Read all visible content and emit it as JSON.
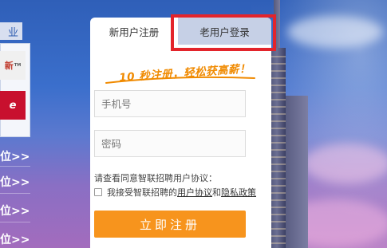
{
  "left": {
    "top_tab": "业",
    "logo_1_text": "新",
    "logo_1_sub": "TM",
    "logo_2_text": "e",
    "links": [
      "位>>",
      "位>>",
      "位>>",
      "位>>"
    ]
  },
  "tabs": {
    "register": "新用户注册",
    "login": "老用户登录"
  },
  "slogan": "10 秒注册，轻松获高薪！",
  "form": {
    "phone_placeholder": "手机号",
    "password_placeholder": "密码",
    "agree_hint": "请查看同意智联招聘用户协议：",
    "agree_prefix": "我接受智联招聘的",
    "user_agreement": "用户协议",
    "and": "和",
    "privacy_policy": "隐私政策",
    "submit": "立即注册"
  },
  "colors": {
    "accent": "#f7941d",
    "highlight": "#e3242b",
    "inactive_tab": "#c6d0e6"
  }
}
